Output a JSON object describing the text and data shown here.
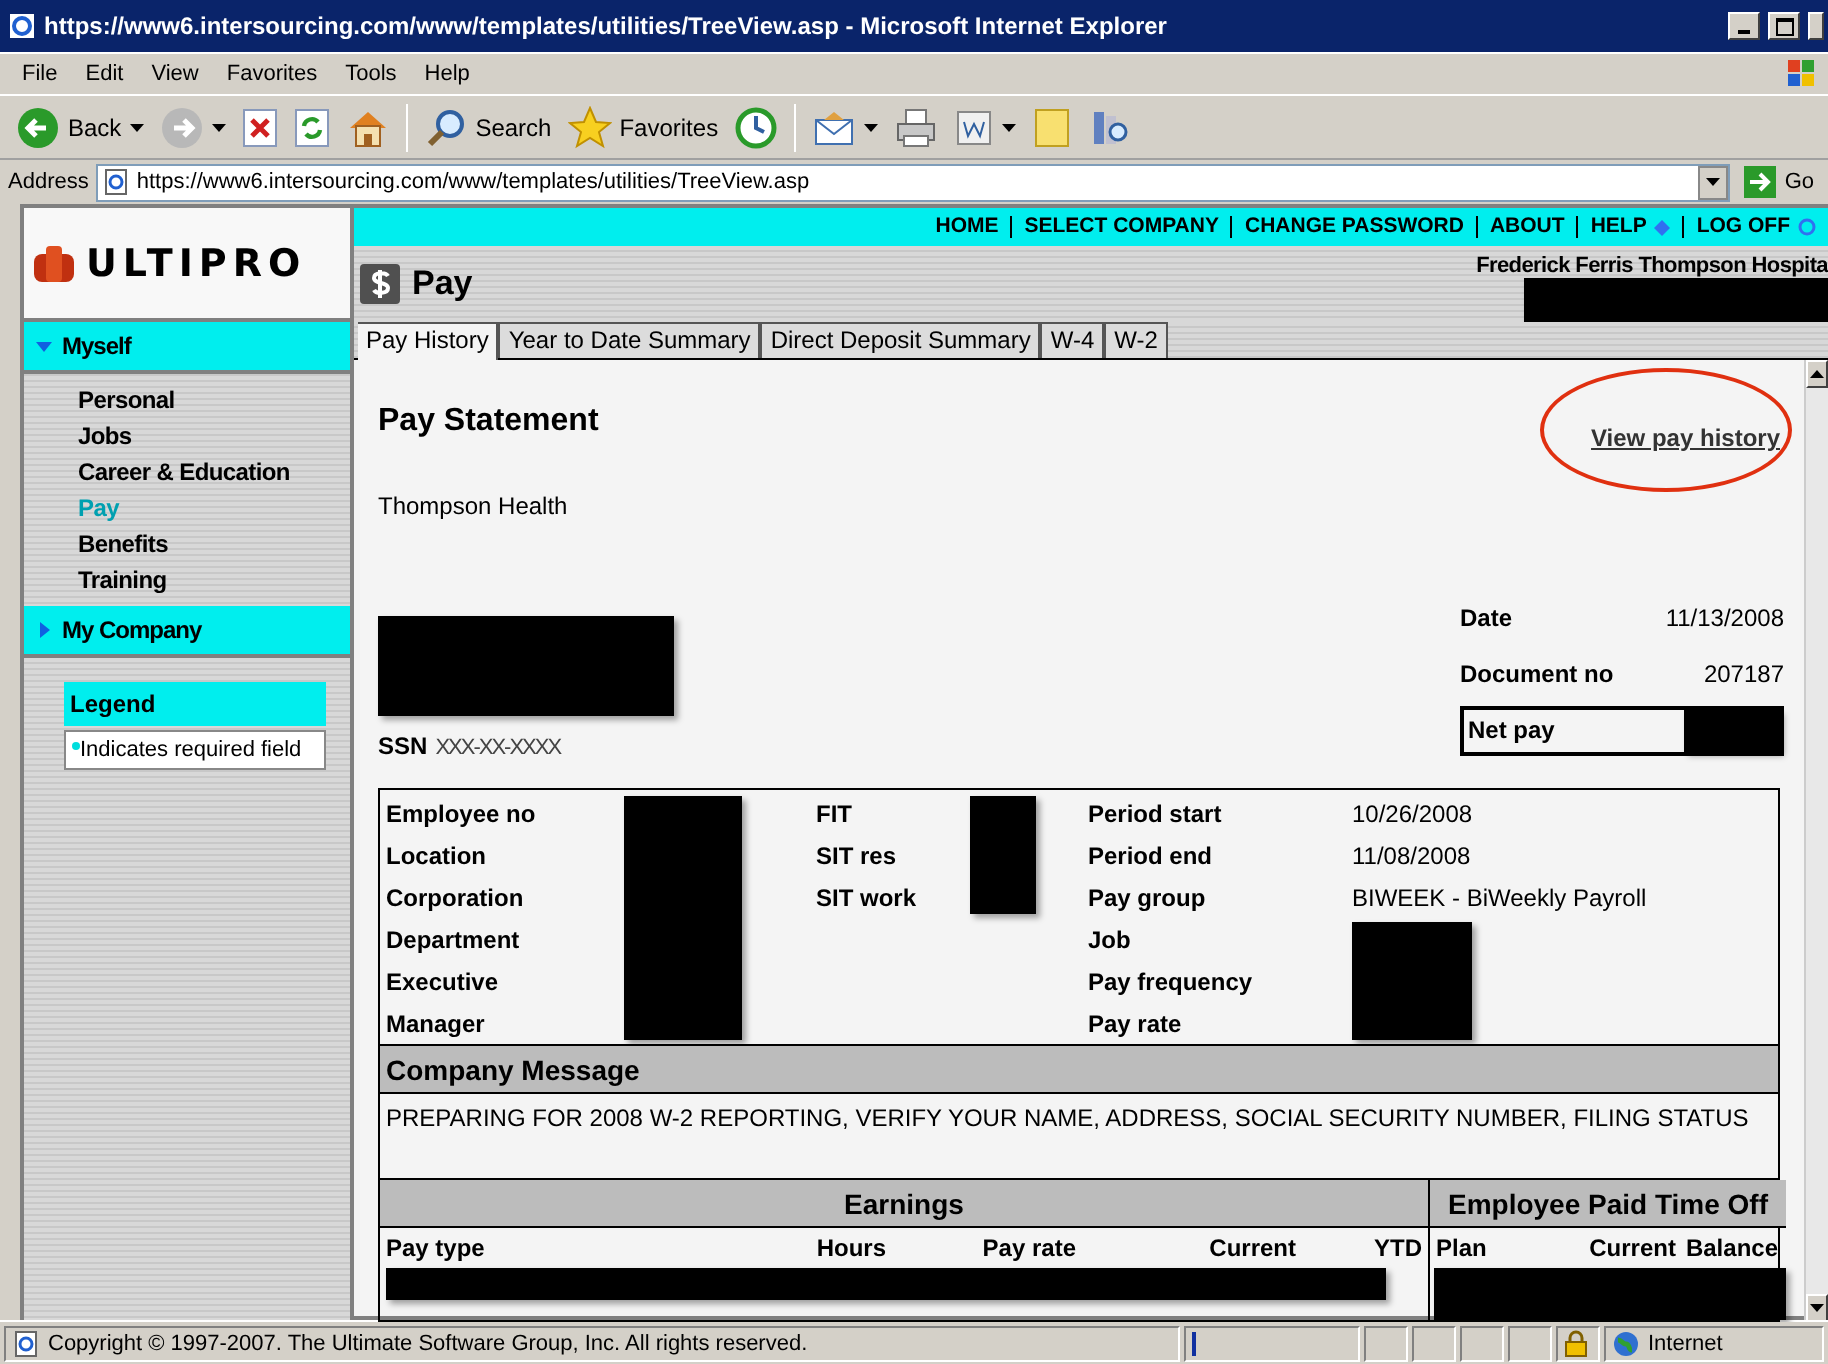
{
  "window": {
    "title": "https://www6.intersourcing.com/www/templates/utilities/TreeView.asp - Microsoft Internet Explorer"
  },
  "menu": [
    "File",
    "Edit",
    "View",
    "Favorites",
    "Tools",
    "Help"
  ],
  "toolbar": [
    {
      "kind": "back",
      "label": "Back",
      "dropdown": true
    },
    {
      "kind": "forward",
      "dropdown": true
    },
    {
      "kind": "stop"
    },
    {
      "kind": "refresh"
    },
    {
      "kind": "home"
    },
    {
      "kind": "search",
      "label": "Search"
    },
    {
      "kind": "favorites",
      "label": "Favorites"
    },
    {
      "kind": "history"
    },
    {
      "kind": "mail",
      "dropdown": true
    },
    {
      "kind": "print"
    },
    {
      "kind": "edit",
      "dropdown": true
    },
    {
      "kind": "note"
    },
    {
      "kind": "research"
    }
  ],
  "address": {
    "label": "Address",
    "url": "https://www6.intersourcing.com/www/templates/utilities/TreeView.asp",
    "go": "Go"
  },
  "top_links": [
    {
      "label": "HOME",
      "kind": "link"
    },
    {
      "label": "SELECT COMPANY",
      "kind": "link"
    },
    {
      "label": "CHANGE PASSWORD",
      "kind": "link"
    },
    {
      "label": "ABOUT",
      "kind": "link"
    },
    {
      "label": "HELP",
      "kind": "help"
    },
    {
      "label": "LOG OFF",
      "kind": "logoff"
    }
  ],
  "logo": "ULTIPRO",
  "section_title": "Pay",
  "company": "Frederick Ferris Thompson Hospita",
  "nav": [
    {
      "label": "Myself",
      "expanded": true,
      "items": [
        {
          "label": "Personal",
          "selected": false
        },
        {
          "label": "Jobs",
          "selected": false
        },
        {
          "label": "Career & Education",
          "selected": false
        },
        {
          "label": "Pay",
          "selected": true
        },
        {
          "label": "Benefits",
          "selected": false
        },
        {
          "label": "Training",
          "selected": false
        }
      ]
    },
    {
      "label": "My Company",
      "expanded": false
    }
  ],
  "legend": {
    "title": "Legend",
    "text": "Indicates required field"
  },
  "tabs": [
    {
      "label": "Pay History",
      "selected": true
    },
    {
      "label": "Year to Date Summary",
      "selected": false
    },
    {
      "label": "Direct Deposit Summary",
      "selected": false
    },
    {
      "label": "W-4",
      "selected": false
    },
    {
      "label": "W-2",
      "selected": false
    }
  ],
  "statement": {
    "title": "Pay Statement",
    "link": "View pay history",
    "employer": "Thompson Health",
    "ssn_label": "SSN",
    "ssn": "XXX-XX-XXXX",
    "date_label": "Date",
    "date": "11/13/2008",
    "document_label": "Document no",
    "document": "207187",
    "net_pay_label": "Net pay"
  },
  "details": [
    [
      {
        "label": "Employee no",
        "redacted": true
      },
      {
        "label": "Location",
        "redacted": true
      },
      {
        "label": "Corporation",
        "redacted": true
      },
      {
        "label": "Department",
        "redacted": true
      },
      {
        "label": "Executive",
        "redacted": true
      },
      {
        "label": "Manager",
        "redacted": true
      }
    ],
    [
      {
        "label": "FIT",
        "redacted": true
      },
      {
        "label": "SIT res",
        "redacted": true
      },
      {
        "label": "SIT work",
        "redacted": true
      }
    ],
    [
      {
        "label": "Period start",
        "value": "10/26/2008"
      },
      {
        "label": "Period end",
        "value": "11/08/2008"
      },
      {
        "label": "Pay group",
        "value": "BIWEEK - BiWeekly Payroll"
      },
      {
        "label": "Job",
        "redacted": true
      },
      {
        "label": "Pay frequency",
        "redacted": true
      },
      {
        "label": "Pay rate",
        "redacted": true
      }
    ]
  ],
  "company_message": {
    "title": "Company Message",
    "text": "PREPARING FOR 2008 W-2 REPORTING, VERIFY YOUR NAME, ADDRESS, SOCIAL SECURITY NUMBER, FILING STATUS"
  },
  "earnings": {
    "title": "Earnings",
    "columns": [
      "Pay type",
      "Hours",
      "Pay rate",
      "Current",
      "YTD"
    ],
    "redacted": true
  },
  "paid_time_off": {
    "title": "Employee Paid Time Off",
    "columns": [
      "Plan",
      "Current",
      "Balance"
    ],
    "redacted": true
  },
  "status_bar": {
    "text": "Copyright © 1997-2007. The Ultimate Software Group, Inc. All rights reserved.",
    "zone": "Internet"
  }
}
